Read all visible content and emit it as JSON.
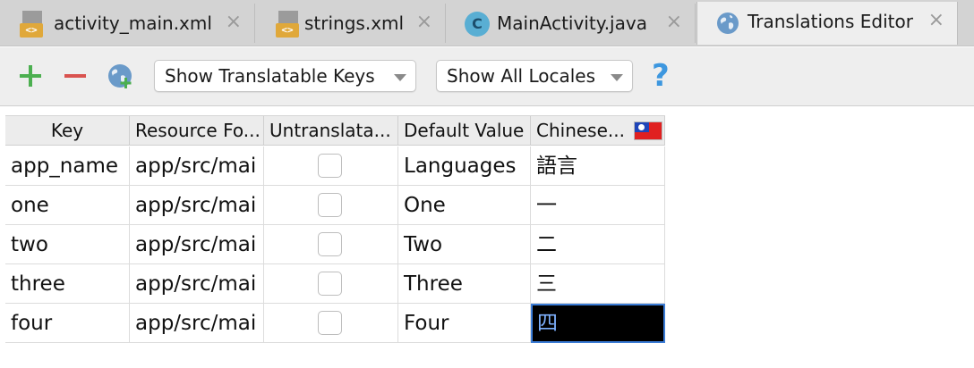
{
  "tabs": [
    {
      "label": "activity_main.xml",
      "icon": "xml-file-icon",
      "active": false
    },
    {
      "label": "strings.xml",
      "icon": "xml-file-icon",
      "active": false
    },
    {
      "label": "MainActivity.java",
      "icon": "java-class-icon",
      "active": false
    },
    {
      "label": "Translations Editor",
      "icon": "globe-icon",
      "active": true
    }
  ],
  "xml_badge": "<>",
  "class_badge": "C",
  "close_glyph": "×",
  "toolbar": {
    "add_icon": "plus-icon",
    "remove_icon": "minus-icon",
    "add_locale_icon": "globe-add-icon",
    "keys_filter": "Show Translatable Keys",
    "locales_filter": "Show All Locales",
    "help": "?"
  },
  "columns": [
    "Key",
    "Resource Fo...",
    "Untranslata...",
    "Default Value",
    "Chinese..."
  ],
  "rows": [
    {
      "key": "app_name",
      "folder": "app/src/mai",
      "untranslatable": false,
      "default": "Languages",
      "chinese": "語言"
    },
    {
      "key": "one",
      "folder": "app/src/mai",
      "untranslatable": false,
      "default": "One",
      "chinese": "一"
    },
    {
      "key": "two",
      "folder": "app/src/mai",
      "untranslatable": false,
      "default": "Two",
      "chinese": "二"
    },
    {
      "key": "three",
      "folder": "app/src/mai",
      "untranslatable": false,
      "default": "Three",
      "chinese": "三"
    },
    {
      "key": "four",
      "folder": "app/src/mai",
      "untranslatable": false,
      "default": "Four",
      "chinese": "四"
    }
  ],
  "selected_cell": {
    "row": 4,
    "column": "chinese"
  },
  "colors": {
    "add": "#4caf50",
    "remove": "#d9534f",
    "help": "#3d97df",
    "selection_bg": "#000000",
    "selection_text": "#7fb2ff"
  }
}
